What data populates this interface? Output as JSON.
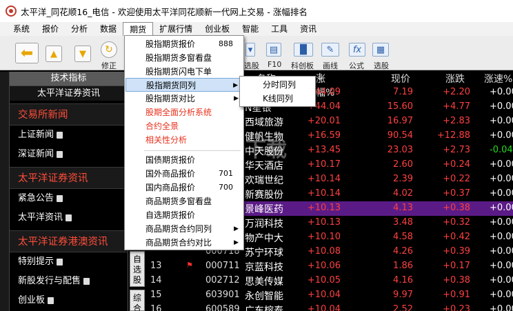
{
  "window": {
    "title": "太平洋_同花顺16_电信 - 欢迎使用太平洋同花顺新一代网上交易 - 涨幅排名"
  },
  "menubar": [
    "系统",
    "报价",
    "分析",
    "数据",
    "期货",
    "扩展行情",
    "创业板",
    "智能",
    "工具",
    "资讯"
  ],
  "toolbar": {
    "labels": {
      "restore": "修正",
      "select": "选股",
      "f10": "F10",
      "chinext": "科创板",
      "draw": "画线",
      "formula": "公式",
      "pick": "选股"
    }
  },
  "left_panel": {
    "header": "技术指标",
    "subheader": "太平洋证券资讯",
    "sections": [
      {
        "title": "交易所新闻",
        "links": [
          "上证新闻",
          "深证新闻"
        ]
      },
      {
        "title": "太平洋证券资讯",
        "links": [
          "紧急公告",
          "太平洋资讯"
        ]
      },
      {
        "title": "太平洋证券港澳资讯",
        "links": [
          "特别提示",
          "新股发行与配售",
          "创业板"
        ]
      }
    ]
  },
  "vertical_tabs": [
    "自选股",
    "综合"
  ],
  "grid": {
    "headers": {
      "name": "名称",
      "pct": "涨幅%",
      "price": "现价",
      "change": "涨跌",
      "speed": "涨速%"
    },
    "rows": [
      {
        "no": "",
        "code": "",
        "name": "",
        "pct": "+44.09",
        "price": "7.19",
        "change": "+2.20",
        "speed": "+0.00"
      },
      {
        "no": "",
        "code": "",
        "name": "N星银",
        "pct": "+44.04",
        "price": "15.60",
        "change": "+4.77",
        "speed": "+0.00"
      },
      {
        "no": "",
        "code": "",
        "name": "西域旅游",
        "pct": "+20.01",
        "price": "16.97",
        "change": "+2.83",
        "speed": "+0.00"
      },
      {
        "no": "",
        "code": "",
        "name": "健帆生物",
        "pct": "+16.59",
        "price": "90.54",
        "change": "+12.88",
        "speed": "+0.00"
      },
      {
        "no": "",
        "code": "",
        "name": "中天股份",
        "pct": "+13.45",
        "price": "23.03",
        "change": "+2.73",
        "speed": "-0.04"
      },
      {
        "no": "",
        "code": "",
        "name": "华天酒店",
        "pct": "+10.17",
        "price": "2.60",
        "change": "+0.24",
        "speed": "+0.00"
      },
      {
        "no": "",
        "code": "",
        "name": "欢瑞世纪",
        "pct": "+10.14",
        "price": "2.39",
        "change": "+0.22",
        "speed": "+0.00"
      },
      {
        "no": "",
        "code": "",
        "name": "新赛股份",
        "pct": "+10.14",
        "price": "4.02",
        "change": "+0.37",
        "speed": "+0.00"
      },
      {
        "no": "",
        "code": "",
        "name": "景峰医药",
        "pct": "+10.13",
        "price": "4.13",
        "change": "+0.38",
        "speed": "+0.00"
      },
      {
        "no": "",
        "code": "",
        "name": "万润科技",
        "pct": "+10.13",
        "price": "3.48",
        "change": "+0.32",
        "speed": "+0.00"
      },
      {
        "no": "",
        "code": "",
        "name": "物产中大",
        "pct": "+10.10",
        "price": "4.58",
        "change": "+0.42",
        "speed": "+0.00"
      },
      {
        "no": "",
        "code": "000718",
        "name": "苏宁环球",
        "pct": "+10.08",
        "price": "4.26",
        "change": "+0.39",
        "speed": "+0.00"
      },
      {
        "no": "13",
        "code": "000711",
        "name": "京蓝科技",
        "pct": "+10.06",
        "price": "1.86",
        "change": "+0.17",
        "speed": "+0.00"
      },
      {
        "no": "14",
        "code": "002712",
        "name": "思美传媒",
        "pct": "+10.05",
        "price": "4.16",
        "change": "+0.38",
        "speed": "+0.00"
      },
      {
        "no": "15",
        "code": "603901",
        "name": "永创智能",
        "pct": "+10.04",
        "price": "9.97",
        "change": "+0.91",
        "speed": "+0.00"
      },
      {
        "no": "16",
        "code": "600589",
        "name": "广东榕泰",
        "pct": "+10.04",
        "price": "2.52",
        "change": "+0.23",
        "speed": "+0.00"
      }
    ]
  },
  "dropdown": {
    "items": [
      {
        "label": "股指期货报价",
        "shortcut": "888"
      },
      {
        "label": "股指期货多窗看盘"
      },
      {
        "label": "股指期货闪电下单"
      },
      {
        "label": "股指期货同列",
        "submenu": true
      },
      {
        "label": "股指期货对比",
        "submenu": true
      },
      {
        "label": "股期全面分析系统"
      },
      {
        "label": "合约全景"
      },
      {
        "label": "相关性分析"
      },
      {
        "label": "国债期货报价"
      },
      {
        "label": "国外商品报价",
        "shortcut": "701"
      },
      {
        "label": "国内商品报价",
        "shortcut": "700"
      },
      {
        "label": "商品期货多窗看盘"
      },
      {
        "label": "自选期货报价"
      },
      {
        "label": "商品期货合约同列",
        "submenu": true
      },
      {
        "label": "商品期货合约对比",
        "submenu": true
      }
    ],
    "submenu": [
      "分时同列",
      "K线同列"
    ]
  },
  "watermark": "安下载",
  "colors": {
    "up": "#ff4040",
    "down": "#22dd22",
    "highlight_row": "#5b1b86",
    "section_title": "#ff4d3a"
  }
}
